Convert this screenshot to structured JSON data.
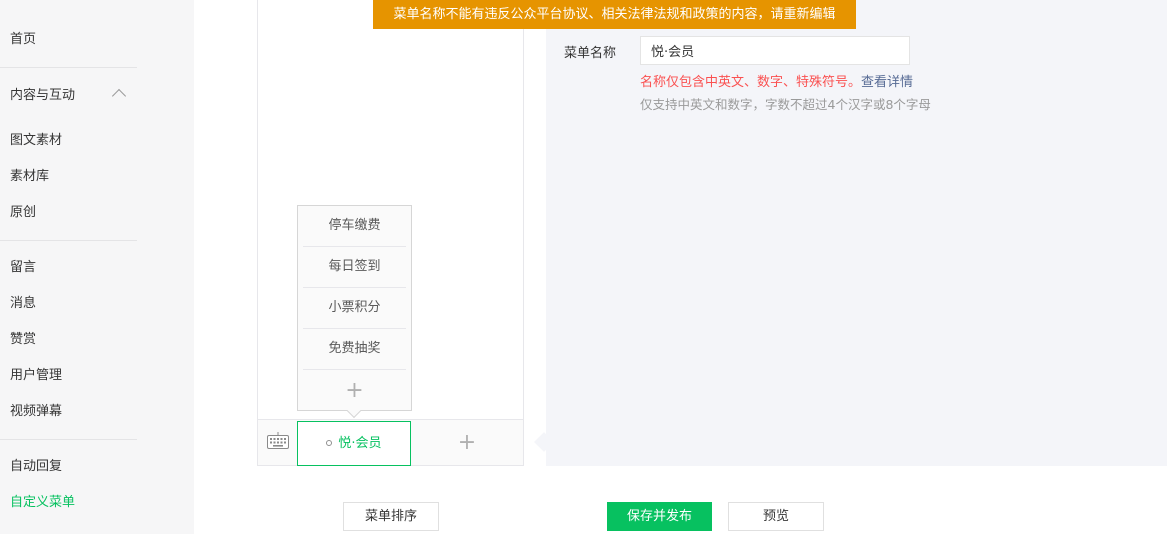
{
  "sidebar": {
    "items": [
      {
        "label": "首页"
      },
      {
        "label": "内容与互动"
      },
      {
        "label": "图文素材"
      },
      {
        "label": "素材库"
      },
      {
        "label": "原创"
      },
      {
        "label": "留言"
      },
      {
        "label": "消息"
      },
      {
        "label": "赞赏"
      },
      {
        "label": "用户管理"
      },
      {
        "label": "视频弹幕"
      },
      {
        "label": "自动回复"
      },
      {
        "label": "自定义菜单"
      }
    ],
    "active_item": "自定义菜单"
  },
  "toast": {
    "text": "菜单名称不能有违反公众平台协议、相关法律法规和政策的内容，请重新编辑"
  },
  "preview": {
    "submenu": [
      "停车缴费",
      "每日签到",
      "小票积分",
      "免费抽奖"
    ],
    "submenu_add": "+",
    "main_menu": "悦·会员",
    "main_add": "+"
  },
  "editor": {
    "name_label": "菜单名称",
    "name_value": "悦·会员",
    "error_text": "名称仅包含中英文、数字、特殊符号。",
    "error_link": "查看详情",
    "hint": "仅支持中英文和数字，字数不超过4个汉字或8个字母"
  },
  "buttons": {
    "sort": "菜单排序",
    "save": "保存并发布",
    "preview": "预览"
  },
  "colors": {
    "primary": "#07c160",
    "toast_bg": "#e69400",
    "error": "#fa5151",
    "link": "#576b95"
  }
}
